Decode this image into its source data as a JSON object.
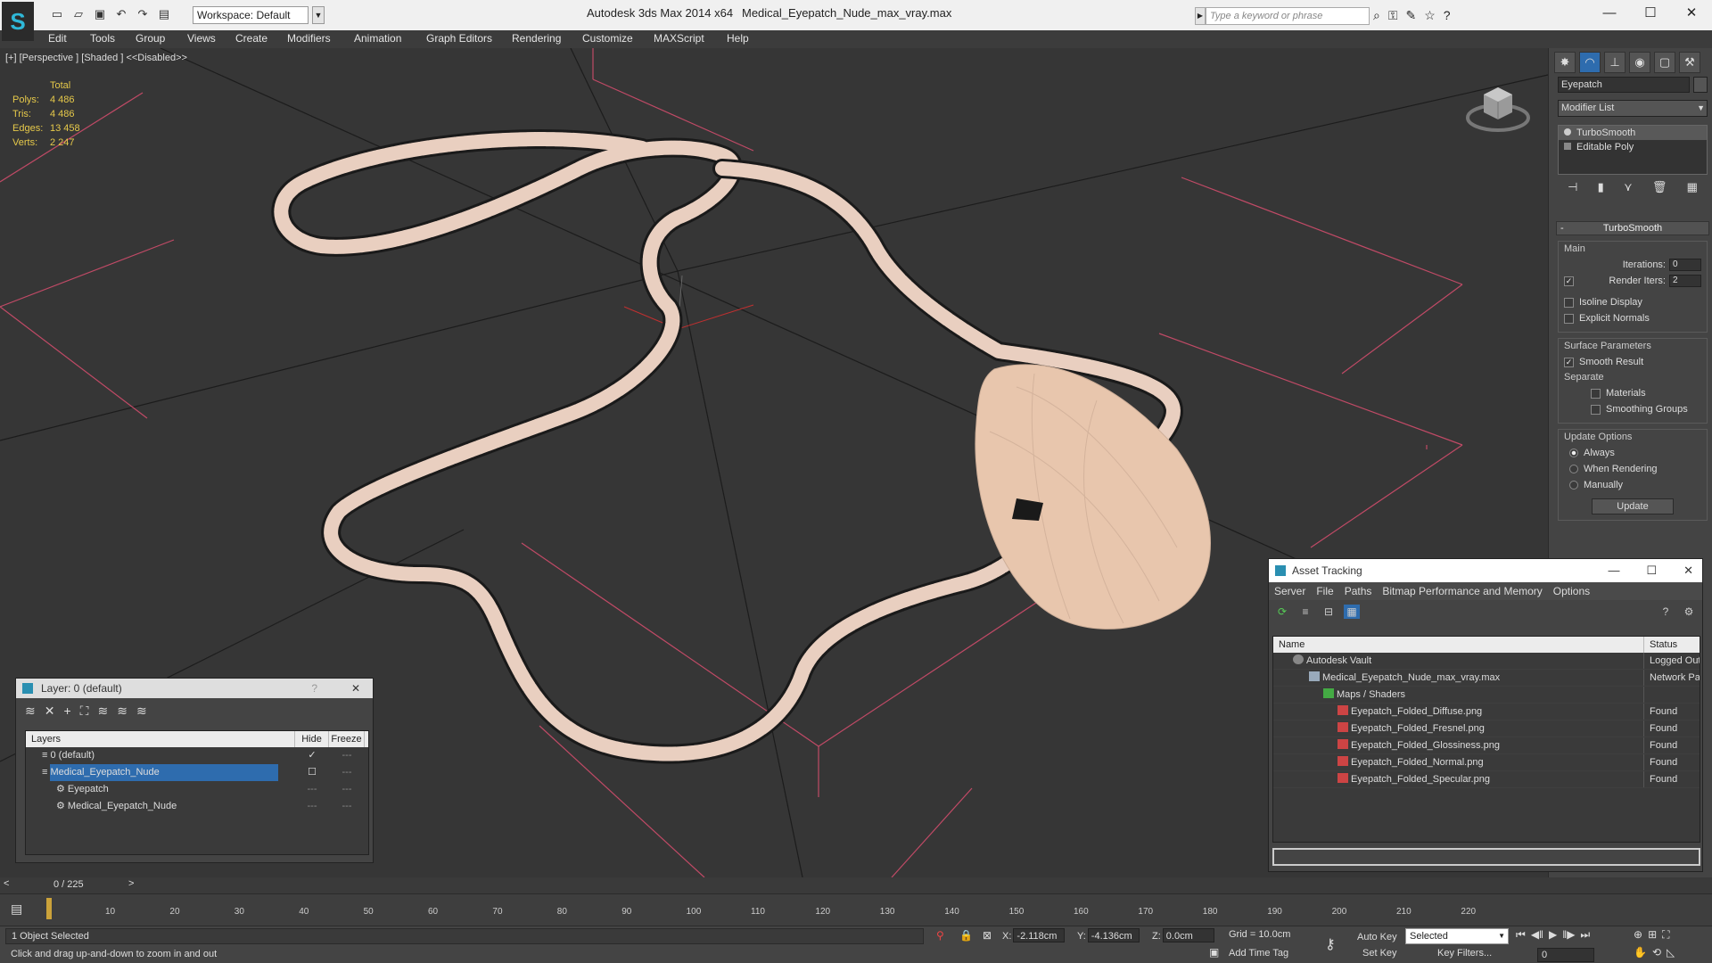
{
  "titlebar": {
    "workspace": "Workspace: Default",
    "app_title": "Autodesk 3ds Max  2014 x64",
    "file_title": "Medical_Eyepatch_Nude_max_vray.max",
    "search_placeholder": "Type a keyword or phrase"
  },
  "menu": [
    "Edit",
    "Tools",
    "Group",
    "Views",
    "Create",
    "Modifiers",
    "Animation",
    "Graph Editors",
    "Rendering",
    "Customize",
    "MAXScript",
    "Help"
  ],
  "viewport": {
    "label": "[+] [Perspective ] [Shaded ]  <<Disabled>>",
    "stats_header": "Total",
    "stats": [
      {
        "k": "Polys:",
        "v": "4 486"
      },
      {
        "k": "Tris:",
        "v": "4 486"
      },
      {
        "k": "Edges:",
        "v": "13 458"
      },
      {
        "k": "Verts:",
        "v": "2 247"
      }
    ]
  },
  "command_panel": {
    "object_name": "Eyepatch",
    "modifier_list": "Modifier List",
    "stack": [
      "TurboSmooth",
      "Editable Poly"
    ],
    "rollout_title": "TurboSmooth",
    "main_group": "Main",
    "iterations_label": "Iterations:",
    "iterations_value": "0",
    "render_iters_label": "Render Iters:",
    "render_iters_value": "2",
    "isoline": "Isoline Display",
    "explicit_normals": "Explicit Normals",
    "surface_group": "Surface Parameters",
    "smooth_result": "Smooth Result",
    "separate_label": "Separate",
    "materials": "Materials",
    "smoothing_groups": "Smoothing Groups",
    "update_group": "Update Options",
    "always": "Always",
    "when_rendering": "When Rendering",
    "manually": "Manually",
    "update_button": "Update"
  },
  "layer_window": {
    "title": "Layer: 0 (default)",
    "col_layers": "Layers",
    "col_hide": "Hide",
    "col_freeze": "Freeze",
    "rows": [
      {
        "name": "0 (default)",
        "indent": 1
      },
      {
        "name": "Medical_Eyepatch_Nude",
        "indent": 1
      },
      {
        "name": "Eyepatch",
        "indent": 2
      },
      {
        "name": "Medical_Eyepatch_Nude",
        "indent": 2
      }
    ]
  },
  "asset_window": {
    "title": "Asset Tracking",
    "menu": [
      "Server",
      "File",
      "Paths",
      "Bitmap Performance and Memory",
      "Options"
    ],
    "col_name": "Name",
    "col_status": "Status",
    "rows": [
      {
        "name": "Autodesk Vault",
        "status": "Logged Out",
        "indent": 1
      },
      {
        "name": "Medical_Eyepatch_Nude_max_vray.max",
        "status": "Network Pa",
        "indent": 2
      },
      {
        "name": "Maps / Shaders",
        "status": "",
        "indent": 3
      },
      {
        "name": "Eyepatch_Folded_Diffuse.png",
        "status": "Found",
        "indent": 4
      },
      {
        "name": "Eyepatch_Folded_Fresnel.png",
        "status": "Found",
        "indent": 4
      },
      {
        "name": "Eyepatch_Folded_Glossiness.png",
        "status": "Found",
        "indent": 4
      },
      {
        "name": "Eyepatch_Folded_Normal.png",
        "status": "Found",
        "indent": 4
      },
      {
        "name": "Eyepatch_Folded_Specular.png",
        "status": "Found",
        "indent": 4
      }
    ]
  },
  "timeline": {
    "frame_counter": "0 / 225",
    "ruler": [
      "10",
      "20",
      "30",
      "40",
      "50",
      "60",
      "70",
      "80",
      "90",
      "100",
      "110",
      "120",
      "130",
      "140",
      "150",
      "160",
      "170",
      "180",
      "190",
      "200",
      "210",
      "220"
    ]
  },
  "status": {
    "selection": "1 Object Selected",
    "prompt": "Click and drag up-and-down to zoom in and out",
    "x_label": "X:",
    "x_value": "-2.118cm",
    "y_label": "Y:",
    "y_value": "-4.136cm",
    "z_label": "Z:",
    "z_value": "0.0cm",
    "grid": "Grid = 10.0cm",
    "add_time_tag": "Add Time Tag",
    "auto_key": "Auto Key",
    "set_key": "Set Key",
    "key_mode": "Selected",
    "key_filters": "Key Filters...",
    "frame": "0"
  }
}
